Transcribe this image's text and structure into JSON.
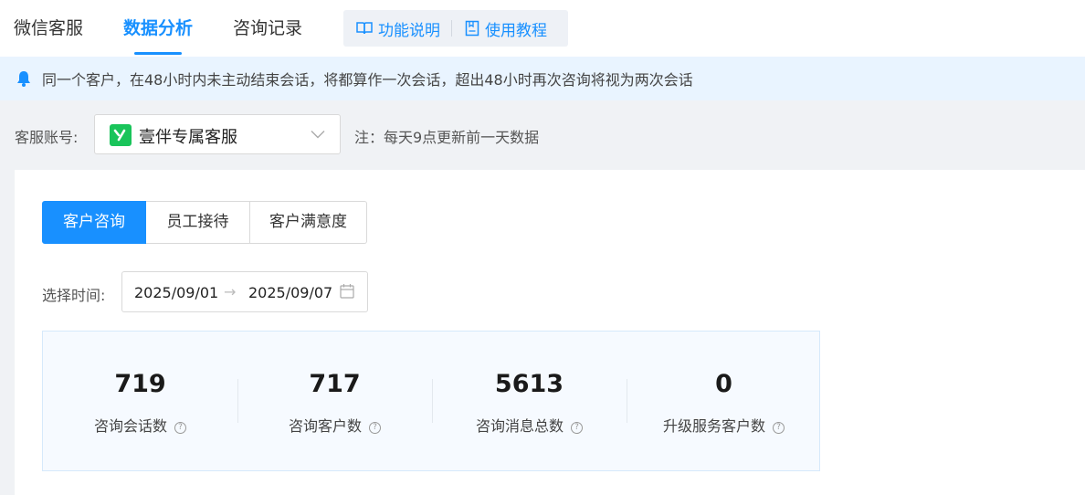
{
  "nav": {
    "tabs": [
      {
        "label": "微信客服",
        "active": false
      },
      {
        "label": "数据分析",
        "active": true
      },
      {
        "label": "咨询记录",
        "active": false
      }
    ],
    "help": {
      "feature_desc": "功能说明",
      "tutorial": "使用教程"
    }
  },
  "notice": {
    "text": "同一个客户，在48小时内未主动结束会话，将都算作一次会话，超出48小时再次咨询将视为两次会话",
    "icon": "bell-icon"
  },
  "account": {
    "label": "客服账号:",
    "selected": "壹伴专属客服",
    "note": "注：每天9点更新前一天数据"
  },
  "segments": [
    {
      "label": "客户咨询",
      "active": true
    },
    {
      "label": "员工接待",
      "active": false
    },
    {
      "label": "客户满意度",
      "active": false
    }
  ],
  "date": {
    "label": "选择时间:",
    "start": "2025/09/01",
    "arrow": "→",
    "end": "2025/09/07"
  },
  "stats": [
    {
      "value": "719",
      "label": "咨询会话数"
    },
    {
      "value": "717",
      "label": "咨询客户数"
    },
    {
      "value": "5613",
      "label": "咨询消息总数"
    },
    {
      "value": "0",
      "label": "升级服务客户数"
    }
  ],
  "colors": {
    "accent": "#1890ff",
    "notice_bg": "#e9f4ff",
    "logo_green": "#19c45a"
  }
}
